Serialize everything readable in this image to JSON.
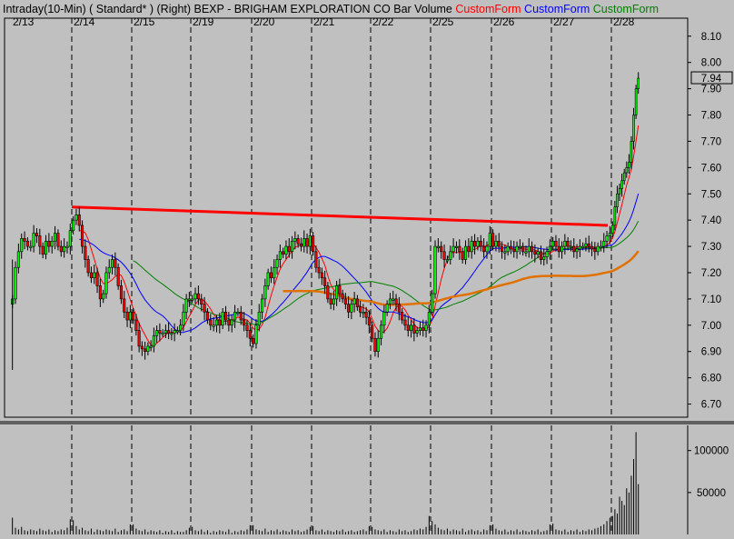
{
  "header": {
    "parts": [
      {
        "text": "Intraday(10-Min)",
        "color": "#000000"
      },
      {
        "text": " ( Standard* )",
        "color": "#000000"
      },
      {
        "text": "   (Right)",
        "color": "#000000"
      },
      {
        "text": "  BEXP - BRIGHAM EXPLORATION CO",
        "color": "#000000"
      },
      {
        "text": "  Bar",
        "color": "#000000"
      },
      {
        "text": "  Volume",
        "color": "#000000"
      },
      {
        "text": "  CustomForm",
        "color": "#ff0000"
      },
      {
        "text": "  CustomForm",
        "color": "#0000ff"
      },
      {
        "text": "  CustomForm",
        "color": "#008000"
      }
    ]
  },
  "colors": {
    "background": "#c0c0c0",
    "up_candle": "#00ff00",
    "down_candle": "#ff0000",
    "resistance_line": "#ff0000",
    "ma_red": "#ff0000",
    "ma_blue": "#0000ff",
    "ma_green": "#008000",
    "ma_orange": "#e07000",
    "volume": "#000000"
  },
  "chart_data": [
    {
      "type": "candlestick",
      "title": "BEXP - BRIGHAM EXPLORATION CO",
      "interval": "Intraday(10-Min)",
      "ylim": [
        6.65,
        8.12
      ],
      "y_ticks": [
        6.7,
        6.8,
        6.9,
        7.0,
        7.1,
        7.2,
        7.3,
        7.4,
        7.5,
        7.6,
        7.7,
        7.8,
        7.9,
        8.0,
        8.1
      ],
      "y_tick_labels": [
        "6.70",
        "6.80",
        "6.90",
        "7.00",
        "7.10",
        "7.20",
        "7.30",
        "7.40",
        "7.50",
        "7.60",
        "7.70",
        "7.80",
        "7.90",
        "8.00",
        "8.10"
      ],
      "last_price": 7.94,
      "last_price_label": "7.94",
      "days": [
        "2/13",
        "2/14",
        "2/15",
        "2/19",
        "2/20",
        "2/21",
        "2/22",
        "2/25",
        "2/26",
        "2/27",
        "2/28"
      ],
      "grid": "vertical dashed at day boundaries",
      "bars_per_day": 20,
      "closes": [
        [
          7.1,
          7.22,
          7.28,
          7.33,
          7.32,
          7.3,
          7.3,
          7.35,
          7.34,
          7.3,
          7.27,
          7.32,
          7.3,
          7.32,
          7.35,
          7.3,
          7.28,
          7.3,
          7.3,
          7.36
        ],
        [
          7.4,
          7.42,
          7.38,
          7.3,
          7.25,
          7.2,
          7.18,
          7.2,
          7.15,
          7.1,
          7.12,
          7.2,
          7.22,
          7.25,
          7.22,
          7.15,
          7.1,
          7.05,
          7.02,
          7.05
        ],
        [
          7.02,
          6.98,
          6.92,
          6.91,
          6.9,
          6.92,
          6.92,
          6.96,
          6.98,
          6.97,
          6.97,
          6.98,
          6.97,
          6.97,
          6.98,
          6.98,
          7.0,
          7.05,
          7.1,
          7.1
        ],
        [
          7.1,
          7.12,
          7.1,
          7.08,
          7.05,
          7.02,
          7.0,
          7.0,
          7.02,
          7.0,
          7.05,
          7.02,
          7.0,
          7.02,
          7.05,
          7.05,
          7.02,
          7.0,
          6.98,
          6.95
        ],
        [
          6.93,
          7.0,
          7.05,
          7.1,
          7.15,
          7.2,
          7.18,
          7.22,
          7.25,
          7.28,
          7.27,
          7.3,
          7.28,
          7.32,
          7.33,
          7.31,
          7.3,
          7.33,
          7.3,
          7.34
        ],
        [
          7.28,
          7.22,
          7.2,
          7.18,
          7.15,
          7.1,
          7.08,
          7.1,
          7.15,
          7.12,
          7.1,
          7.08,
          7.05,
          7.08,
          7.1,
          7.07,
          7.05,
          7.05,
          7.03,
          7.0
        ],
        [
          6.95,
          6.9,
          6.95,
          7.0,
          7.05,
          7.08,
          7.1,
          7.1,
          7.08,
          7.05,
          7.02,
          7.0,
          6.98,
          7.0,
          6.97,
          6.98,
          6.99,
          6.98,
          7.0,
          7.05
        ],
        [
          7.12,
          7.3,
          7.3,
          7.28,
          7.25,
          7.25,
          7.28,
          7.3,
          7.3,
          7.28,
          7.25,
          7.3,
          7.28,
          7.32,
          7.3,
          7.32,
          7.3,
          7.28,
          7.3,
          7.35
        ],
        [
          7.3,
          7.32,
          7.3,
          7.28,
          7.28,
          7.3,
          7.29,
          7.28,
          7.3,
          7.3,
          7.28,
          7.28,
          7.3,
          7.28,
          7.27,
          7.28,
          7.25,
          7.26,
          7.28,
          7.3
        ],
        [
          7.32,
          7.3,
          7.28,
          7.3,
          7.32,
          7.3,
          7.3,
          7.28,
          7.29,
          7.3,
          7.3,
          7.31,
          7.3,
          7.29,
          7.28,
          7.3,
          7.3,
          7.32,
          7.34,
          7.35
        ],
        [
          7.38,
          7.45,
          7.5,
          7.52,
          7.55,
          7.58,
          7.6,
          7.62,
          7.7,
          7.8,
          7.9,
          7.94
        ]
      ],
      "resistance_line": {
        "start_price": 7.45,
        "end_price": 7.38
      }
    },
    {
      "type": "bar",
      "title": "Volume",
      "ylim": [
        0,
        130000
      ],
      "y_ticks": [
        50000,
        100000
      ],
      "y_tick_labels": [
        "50000",
        "100000"
      ],
      "values": [
        [
          20000,
          8000,
          6000,
          9000,
          5000,
          4000,
          6000,
          5000,
          4000,
          7000,
          5000,
          4000,
          6000,
          3000,
          5000,
          4000,
          6000,
          5000,
          8000,
          18000
        ],
        [
          17000,
          10000,
          6000,
          8000,
          5000,
          4000,
          7000,
          3000,
          6000,
          5000,
          4000,
          6000,
          5000,
          4000,
          7000,
          3000,
          5000,
          6000,
          4000,
          12000
        ],
        [
          12000,
          7000,
          5000,
          4000,
          6000,
          3000,
          5000,
          4000,
          3000,
          5000,
          2000,
          4000,
          3000,
          5000,
          2000,
          4000,
          3000,
          3000,
          5000,
          8000
        ],
        [
          9000,
          5000,
          4000,
          6000,
          3000,
          5000,
          2000,
          4000,
          3000,
          5000,
          4000,
          3000,
          6000,
          2000,
          4000,
          3000,
          5000,
          4000,
          6000,
          11000
        ],
        [
          11000,
          6000,
          5000,
          4000,
          7000,
          3000,
          5000,
          4000,
          6000,
          3000,
          5000,
          4000,
          3000,
          6000,
          4000,
          5000,
          3000,
          4000,
          6000,
          9000
        ],
        [
          10000,
          5000,
          4000,
          6000,
          3000,
          5000,
          4000,
          3000,
          5000,
          4000,
          6000,
          3000,
          4000,
          5000,
          3000,
          4000,
          5000,
          6000,
          4000,
          10000
        ],
        [
          9000,
          6000,
          5000,
          4000,
          6000,
          3000,
          5000,
          4000,
          3000,
          6000,
          4000,
          5000,
          3000,
          4000,
          6000,
          5000,
          7000,
          6000,
          9000,
          22000
        ],
        [
          16000,
          12000,
          8000,
          6000,
          5000,
          7000,
          4000,
          6000,
          5000,
          4000,
          7000,
          3000,
          5000,
          6000,
          4000,
          5000,
          3000,
          6000,
          5000,
          11000
        ],
        [
          12000,
          7000,
          5000,
          4000,
          6000,
          3000,
          5000,
          4000,
          6000,
          3000,
          5000,
          4000,
          3000,
          5000,
          4000,
          6000,
          3000,
          4000,
          5000,
          12000
        ],
        [
          13000,
          6000,
          5000,
          4000,
          6000,
          3000,
          5000,
          4000,
          6000,
          3000,
          5000,
          4000,
          6000,
          5000,
          7000,
          8000,
          10000,
          12000,
          16000,
          20000
        ],
        [
          22000,
          30000,
          25000,
          45000,
          40000,
          35000,
          55000,
          50000,
          70000,
          90000,
          122000,
          60000
        ]
      ]
    }
  ]
}
